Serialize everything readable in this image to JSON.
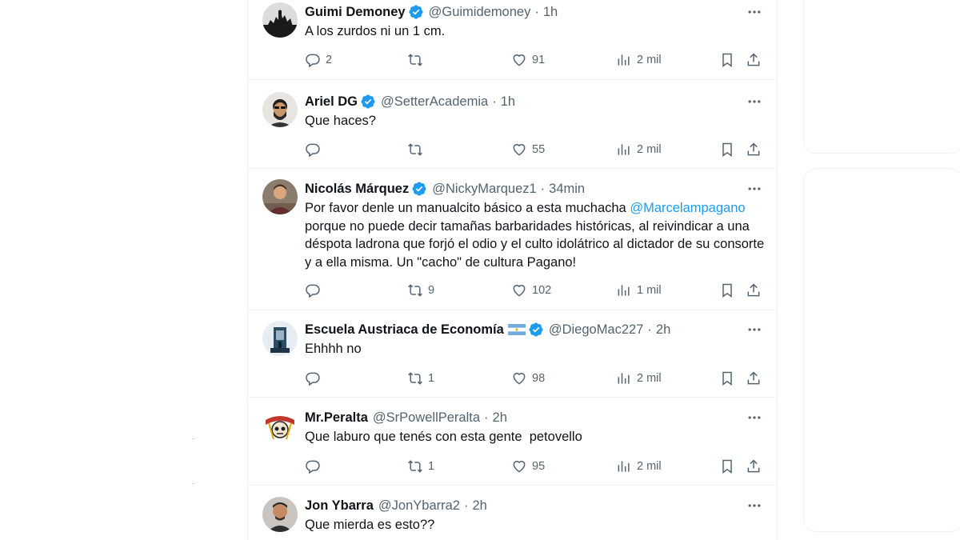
{
  "colors": {
    "accent": "#1d9bf0",
    "text": "#0f1419",
    "secondary": "#536471",
    "border": "#eff3f4"
  },
  "tweets": [
    {
      "name": "Guimi Demoney",
      "verified": true,
      "flag": false,
      "handle": "@Guimidemoney",
      "sep": "·",
      "time": "1h",
      "text_parts": [
        "A los zurdos ni un 1 cm."
      ],
      "mention": "",
      "replies": "2",
      "retweets": "",
      "likes": "91",
      "views": "2 mil",
      "avatar_icon": "silhouette-avatar"
    },
    {
      "name": "Ariel DG",
      "verified": true,
      "flag": false,
      "handle": "@SetterAcademia",
      "sep": "·",
      "time": "1h",
      "text_parts": [
        "Que haces?"
      ],
      "mention": "",
      "replies": "",
      "retweets": "",
      "likes": "55",
      "views": "2 mil",
      "avatar_icon": "bearded-man-avatar"
    },
    {
      "name": "Nicolás Márquez",
      "verified": true,
      "flag": false,
      "handle": "@NickyMarquez1",
      "sep": "·",
      "time": "34min",
      "text_before": "Por favor denle un manualcito básico a esta muchacha ",
      "mention": "@Marcelampagano",
      "text_after": " porque no puede decir tamañas barbaridades históricas, al reivindicar a una déspota ladrona que forjó el odio y el culto idolátrico al dictador de su consorte y a ella misma. Un \"cacho\" de cultura Pagano!",
      "replies": "",
      "retweets": "9",
      "likes": "102",
      "views": "1 mil",
      "avatar_icon": "man-avatar"
    },
    {
      "name": "Escuela Austriaca de Economía",
      "verified": true,
      "flag": true,
      "handle": "@DiegoMac227",
      "sep": "·",
      "time": "2h",
      "text_parts": [
        "Ehhhh no"
      ],
      "mention": "",
      "replies": "",
      "retweets": "1",
      "likes": "98",
      "views": "2 mil",
      "avatar_icon": "monument-avatar"
    },
    {
      "name": "Mr.Peralta",
      "verified": false,
      "flag": false,
      "handle": "@SrPowellPeralta",
      "sep": "·",
      "time": "2h",
      "text_parts": [
        "Que laburo que tenés con esta gente  petovello"
      ],
      "mention": "",
      "replies": "",
      "retweets": "1",
      "likes": "95",
      "views": "2 mil",
      "avatar_icon": "skull-logo-avatar"
    },
    {
      "name": "Jon Ybarra",
      "verified": false,
      "flag": false,
      "handle": "@JonYbarra2",
      "sep": "·",
      "time": "2h",
      "text_parts": [
        "Que mierda es esto??"
      ],
      "mention": "",
      "replies": "",
      "retweets": "",
      "likes": "",
      "views": "",
      "avatar_icon": "man-avatar"
    }
  ]
}
